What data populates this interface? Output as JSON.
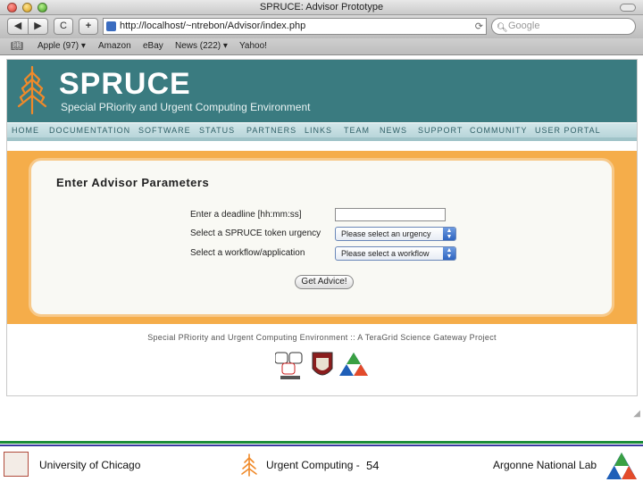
{
  "browser": {
    "window_title": "SPRUCE: Advisor Prototype",
    "url": "http://localhost/~ntrebon/Advisor/index.php",
    "search_placeholder": "Google",
    "back_label": "◀",
    "forward_label": "▶",
    "reload_label": "C",
    "add_label": "+",
    "bookmarks": [
      {
        "label": "Apple (97) ▾"
      },
      {
        "label": "Amazon"
      },
      {
        "label": "eBay"
      },
      {
        "label": "News (222) ▾"
      },
      {
        "label": "Yahoo!"
      }
    ]
  },
  "site": {
    "brand": "SPRUCE",
    "tagline": "Special PRiority and Urgent Computing Environment",
    "nav": [
      "HOME",
      "DOCUMENTATION",
      "SOFTWARE",
      "STATUS",
      "PARTNERS",
      "LINKS",
      "TEAM",
      "NEWS",
      "SUPPORT",
      "COMMUNITY",
      "USER PORTAL"
    ],
    "colors": {
      "banner": "#3a7b80",
      "content_bg": "#f5ad4a",
      "nav": "#b8d5da"
    }
  },
  "form": {
    "title": "Enter Advisor Parameters",
    "deadline_label": "Enter a deadline [hh:mm:ss]",
    "deadline_value": "",
    "urgency_label": "Select a SPRUCE token urgency",
    "urgency_selected": "Please select an urgency",
    "workflow_label": "Select a workflow/application",
    "workflow_selected": "Please select a workflow",
    "submit_label": "Get Advice!"
  },
  "footer": {
    "text": "Special PRiority and Urgent Computing Environment :: A TeraGrid Science Gateway Project"
  },
  "slide": {
    "left": "University of Chicago",
    "middle": "Urgent Computing -",
    "page_number": "54",
    "right": "Argonne National Lab"
  }
}
